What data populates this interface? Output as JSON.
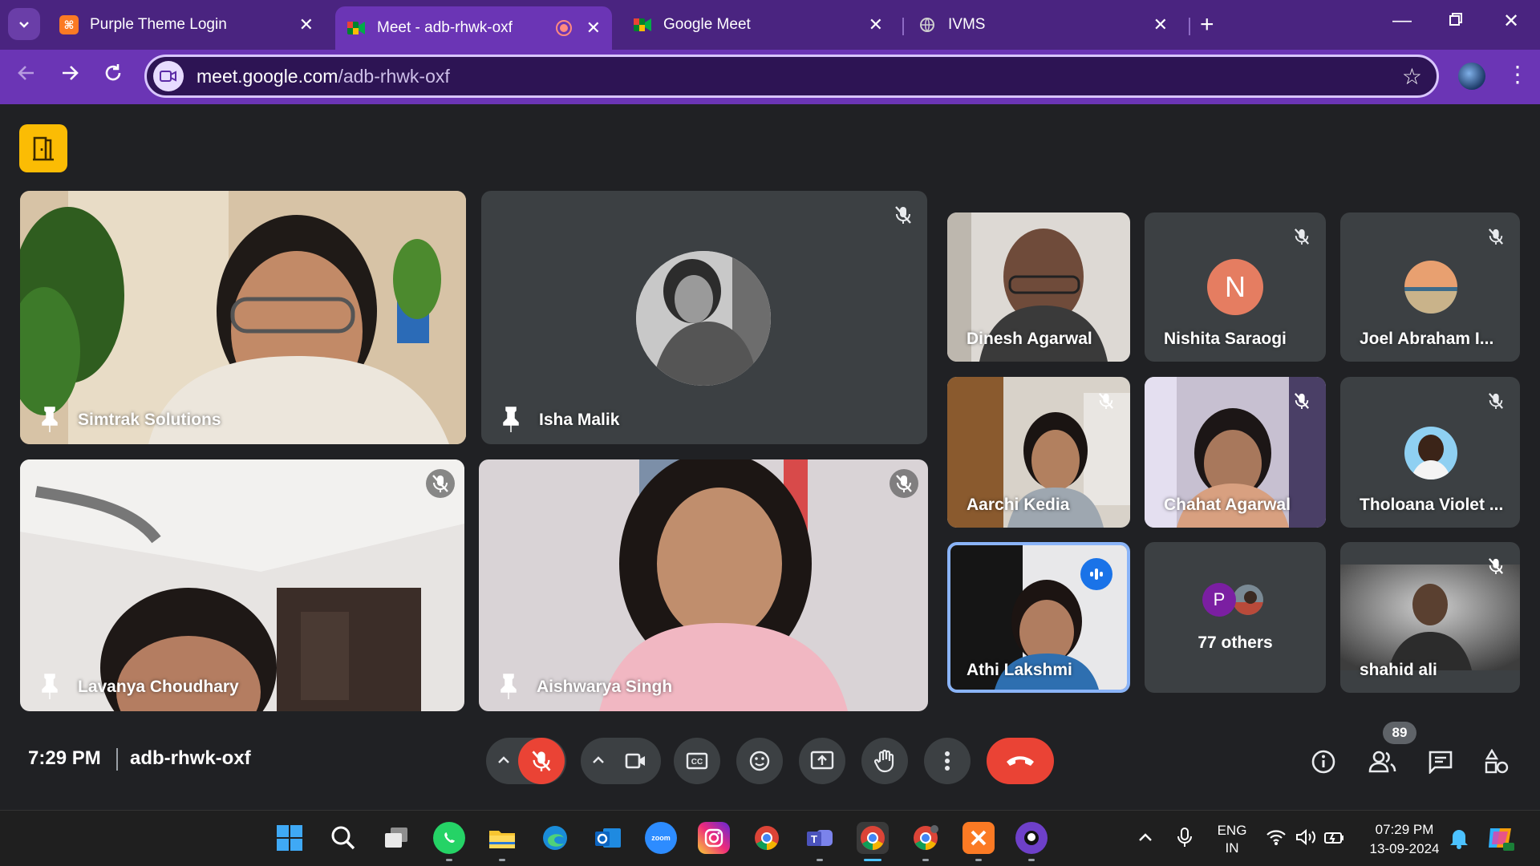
{
  "browser": {
    "tabs": [
      {
        "label": "Purple Theme Login",
        "favicon": "xampp-icon",
        "color": "#fb7a24"
      },
      {
        "label": "Meet - adb-rhwk-oxf",
        "favicon": "google-meet-icon",
        "recording": true
      },
      {
        "label": "Google Meet",
        "favicon": "google-meet-icon"
      },
      {
        "label": "IVMS",
        "favicon": "globe-icon"
      }
    ],
    "active_tab_index": 1,
    "url_host": "meet.google.com",
    "url_path": "/adb-rhwk-oxf"
  },
  "meet": {
    "main_tiles": [
      {
        "name": "Simtrak Solutions",
        "pinned": false,
        "muted": false
      },
      {
        "name": "Isha Malik",
        "pinned": false,
        "muted": true
      },
      {
        "name": "Lavanya Choudhary",
        "pinned": false,
        "muted": true
      },
      {
        "name": "Aishwarya Singh",
        "pinned": false,
        "muted": true
      }
    ],
    "side_tiles": [
      {
        "name": "Dinesh Agarwal",
        "muted": false
      },
      {
        "name": "Nishita Saraogi",
        "muted": true,
        "avatar_letter": "N"
      },
      {
        "name": "Joel Abraham I...",
        "muted": true
      },
      {
        "name": "Aarchi Kedia",
        "muted": true
      },
      {
        "name": "Chahat Agarwal",
        "muted": true
      },
      {
        "name": "Tholoana Violet ...",
        "muted": true
      },
      {
        "name": "Athi Lakshmi",
        "speaking": true
      },
      {
        "name": "77 others",
        "avatar_letter": "P"
      },
      {
        "name": "shahid ali",
        "muted": true
      }
    ],
    "time": "7:29 PM",
    "meeting_code": "adb-rhwk-oxf",
    "participant_count": "89",
    "controls": [
      "microphone-off",
      "camera",
      "captions",
      "reactions",
      "present",
      "raise-hand",
      "more-options",
      "leave-call"
    ],
    "side_controls": [
      "meeting-details",
      "people",
      "chat",
      "activities"
    ]
  },
  "taskbar": {
    "language": "ENG",
    "region": "IN",
    "clock_time": "07:29 PM",
    "clock_date": "13-09-2024",
    "zoom_label": "zoom"
  },
  "colors": {
    "tab_strip": "#4a2480",
    "toolbar": "#6b35b5",
    "meet_bg": "#202124",
    "danger": "#ea4335",
    "speaking": "#1a73e8"
  }
}
